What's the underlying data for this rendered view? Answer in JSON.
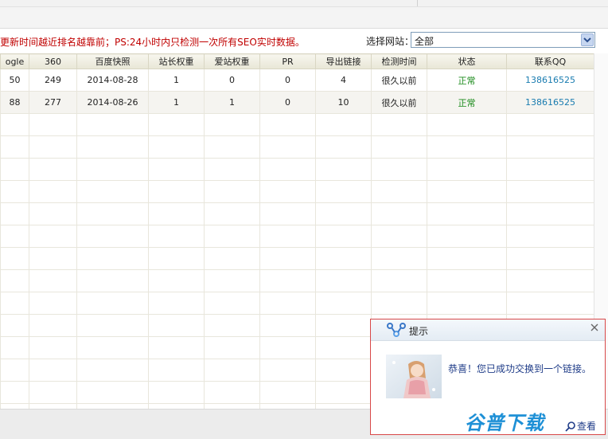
{
  "notice": "更新时间越近排名越靠前；PS:24小时内只检测一次所有SEO实时数据。",
  "site_select": {
    "label": "选择网站：",
    "value": "全部"
  },
  "table": {
    "headers": [
      "ogle",
      "360",
      "百度快照",
      "站长权重",
      "爱站权重",
      "PR",
      "导出链接",
      "检测时间",
      "状态",
      "联系QQ"
    ],
    "rows": [
      [
        "50",
        "249",
        "2014-08-28",
        "1",
        "0",
        "0",
        "4",
        "很久以前",
        "正常",
        "138616525"
      ],
      [
        "88",
        "277",
        "2014-08-26",
        "1",
        "1",
        "0",
        "10",
        "很久以前",
        "正常",
        "138616525"
      ]
    ]
  },
  "popup": {
    "title": "提示",
    "message": "恭喜！您已成功交换到一个链接。",
    "watermark": "谷普下载",
    "view_label": "查看"
  },
  "colors": {
    "notice_text": "#c00000",
    "status_ok": "#1a8a1a",
    "qq_link": "#1a7cb0",
    "popup_border": "#d84848"
  }
}
